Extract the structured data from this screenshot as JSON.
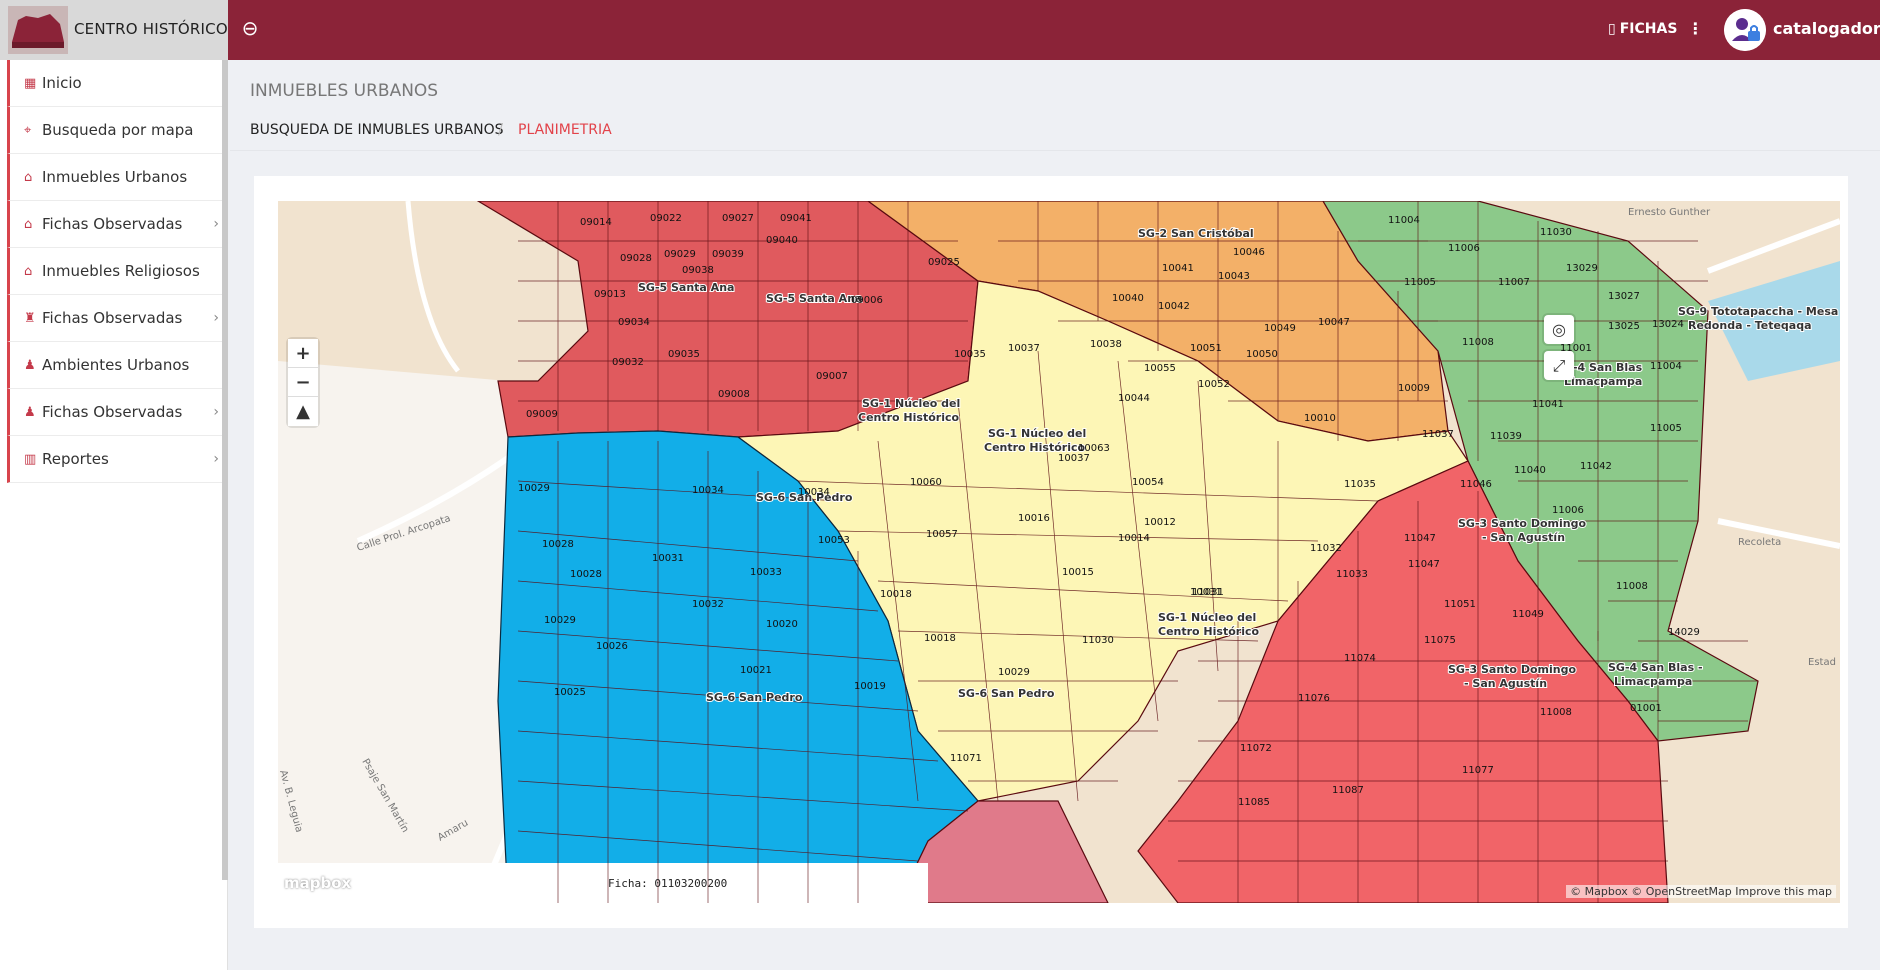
{
  "header": {
    "brand": "CENTRO HISTÓRICO",
    "fichas_label": "FICHAS",
    "user_name": "catalogador"
  },
  "sidebar": {
    "items": [
      {
        "label": "Inicio",
        "icon": "grid-icon",
        "chevron": false
      },
      {
        "label": "Busqueda por mapa",
        "icon": "map-pin-icon",
        "chevron": false
      },
      {
        "label": "Inmuebles Urbanos",
        "icon": "home-icon",
        "chevron": false
      },
      {
        "label": "Fichas Observadas",
        "icon": "home-icon",
        "chevron": true
      },
      {
        "label": "Inmuebles Religiosos",
        "icon": "home-icon",
        "chevron": false
      },
      {
        "label": "Fichas Observadas",
        "icon": "church-icon",
        "chevron": true
      },
      {
        "label": "Ambientes Urbanos",
        "icon": "road-icon",
        "chevron": false
      },
      {
        "label": "Fichas Observadas",
        "icon": "road-icon",
        "chevron": true
      },
      {
        "label": "Reportes",
        "icon": "bar-chart-icon",
        "chevron": true
      }
    ]
  },
  "page": {
    "title": "INMUEBLES URBANOS",
    "breadcrumb_parent": "BUSQUEDA DE INMUBLES URBANOS",
    "breadcrumb_current": "PLANIMETRIA"
  },
  "map": {
    "ficha_label": "Ficha: 01103200200",
    "mapbox_logo": "mapbox",
    "attribution": [
      "© Mapbox",
      "© OpenStreetMap",
      "Improve this map"
    ],
    "zoom_in": "+",
    "zoom_out": "−",
    "compass": "▲",
    "zones": [
      {
        "name": "SG-5 Santa Ana",
        "color": "#e05a5e"
      },
      {
        "name": "SG-2 San Cristóbal",
        "color": "#f3b068"
      },
      {
        "name": "SG-9 Tototapaccha - Mesa Redonda - Teteqaqa",
        "color": "#8cc98a"
      },
      {
        "name": "SG-4 San Blas - Limacpampa",
        "color": "#8cc98a"
      },
      {
        "name": "SG-1 Núcleo del Centro Histórico",
        "color": "#fdf6b6"
      },
      {
        "name": "SG-6 San Pedro",
        "color": "#12aee8"
      },
      {
        "name": "SG-3 Santo Domingo - San Agustín",
        "color": "#f16468"
      }
    ],
    "zone_labels": [
      "SG-5 Santa Ana",
      "SG-5 Santa Ana",
      "SG-2 San Cristóbal",
      "SG-9 Tototapaccha - Mesa",
      "Redonda - Teteqaqa",
      "SG-4 San Blas",
      "Limacpampa",
      "SG-1 Núcleo del",
      "Centro Histórico",
      "SG-1 Núcleo del",
      "Centro Histórico",
      "SG-6 San Pedro",
      "SG-3 Santo Domingo",
      "- San Agustín",
      "SG-1 Núcleo del",
      "Centro Histórico",
      "SG-6 San Pedro",
      "SG-6 San Pedro",
      "SG-3 Santo Domingo",
      "- San Agustín",
      "SG-4 San Blas -",
      "Limacpampa"
    ],
    "parcel_labels": [
      "09014",
      "09022",
      "09027",
      "09041",
      "09040",
      "09028",
      "09029",
      "09039",
      "09038",
      "09013",
      "09034",
      "09035",
      "09032",
      "09008",
      "09009",
      "09006",
      "09007",
      "09025",
      "10046",
      "10041",
      "10043",
      "10040",
      "10042",
      "10049",
      "10047",
      "10038",
      "10037",
      "10051",
      "10050",
      "10055",
      "10052",
      "10035",
      "10009",
      "10010",
      "10044",
      "10037",
      "10060",
      "10063",
      "10034",
      "10054",
      "10012",
      "10057",
      "10016",
      "10014",
      "10015",
      "10031",
      "10032",
      "10033",
      "10018",
      "10018",
      "10020",
      "10021",
      "10019",
      "10029",
      "10028",
      "10029",
      "10026",
      "10025",
      "10028",
      "10031",
      "10053",
      "10034",
      "10029",
      "11004",
      "11006",
      "11030",
      "11005",
      "11007",
      "13029",
      "13027",
      "11008",
      "11001",
      "13025",
      "13024",
      "11004",
      "11041",
      "11039",
      "11037",
      "11042",
      "11040",
      "11005",
      "11035",
      "11046",
      "11032",
      "11047",
      "11047",
      "11033",
      "11031",
      "11030",
      "11006",
      "11008",
      "11051",
      "11049",
      "14029",
      "11075",
      "11074",
      "11076",
      "11008",
      "11072",
      "11077",
      "11087",
      "11071",
      "11085",
      "01001"
    ],
    "streets": [
      "Ernesto Gunther",
      "Recoleta",
      "Calle Prol. Arcopata",
      "Psaje San Martín",
      "Av. B. Leguia",
      "Amaru",
      "Estad"
    ]
  }
}
